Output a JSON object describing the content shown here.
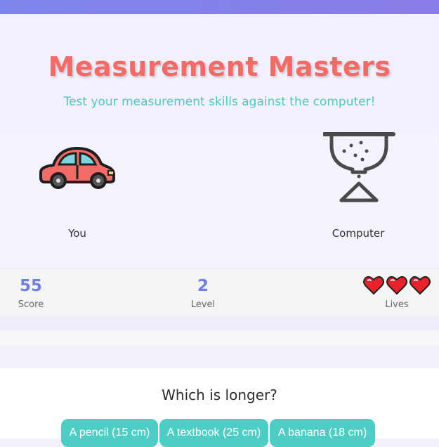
{
  "header": {
    "title": "Measurement Masters",
    "subtitle": "Test your measurement skills against the computer!"
  },
  "players": {
    "player_label": "You",
    "player_icon": "car-icon",
    "computer_label": "Computer",
    "computer_icon": "hourglass-icon"
  },
  "stats": {
    "score_value": "55",
    "score_label": "Score",
    "level_value": "2",
    "level_label": "Level",
    "lives_count": 3,
    "lives_label": "Lives"
  },
  "question": {
    "text": "Which is longer?",
    "options": [
      "A pencil (15 cm)",
      "A textbook (25 cm)",
      "A banana (18 cm)"
    ]
  },
  "colors": {
    "title": "#f26b66",
    "subtitle": "#4fc6bf",
    "accent": "#6f7de3",
    "option_button": "#4ecdc4",
    "heart": "#e8222a"
  }
}
